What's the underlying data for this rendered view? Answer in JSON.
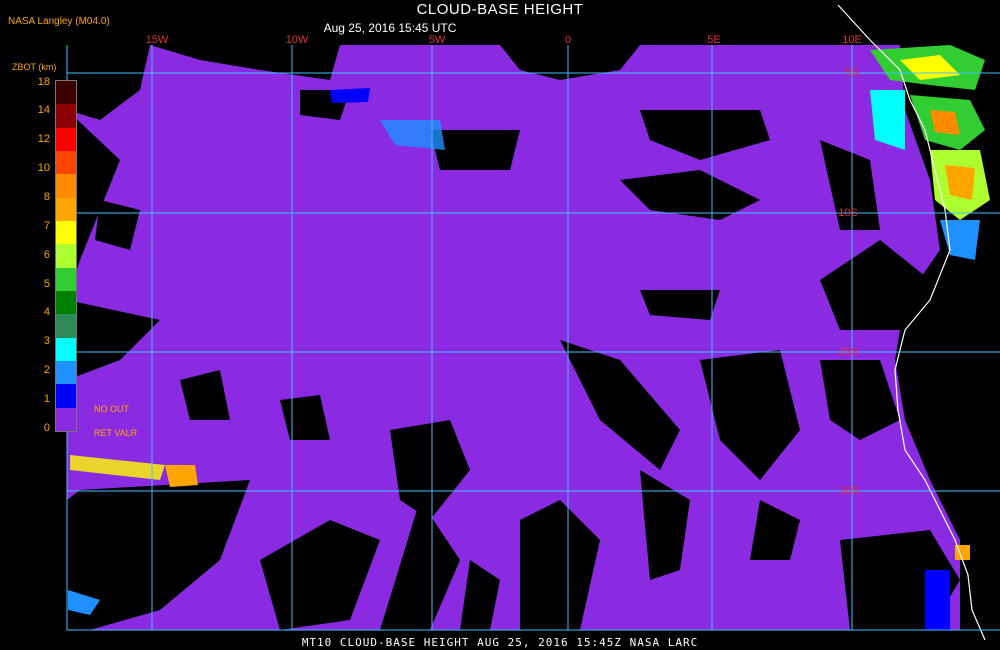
{
  "title": "CLOUD-BASE HEIGHT",
  "subtitle": "Aug 25, 2016 15:45 UTC",
  "source": "NASA Langley (M04.0)",
  "footer": "MT10  CLOUD-BASE HEIGHT   AUG 25, 2016 15:45Z   NASA LARC",
  "legend": {
    "title": "ZBOT (km)",
    "ticks": [
      "18",
      "14",
      "12",
      "10",
      "8",
      "7",
      "6",
      "5",
      "4",
      "3",
      "2",
      "1",
      "0"
    ],
    "colors": [
      "#3a0000",
      "#8b0000",
      "#ff0000",
      "#ff4500",
      "#ff8c00",
      "#ffa500",
      "#ffff00",
      "#adff2f",
      "#32cd32",
      "#008000",
      "#2e8b57",
      "#00ffff",
      "#1e90ff",
      "#0000ff",
      "#8a2be2"
    ],
    "no_out": "NO    OUT",
    "ret_valr": "RET   VALR"
  },
  "map": {
    "lon_labels": [
      "15W",
      "10W",
      "5W",
      "0",
      "5E",
      "10E"
    ],
    "lat_labels": [
      "5S",
      "10S",
      "15S",
      "20S"
    ],
    "ocean_cloud_color": "#8a2be2",
    "clear_color": "#000000",
    "grid_color": "#40c0ff",
    "coast_color": "#ffffff"
  }
}
